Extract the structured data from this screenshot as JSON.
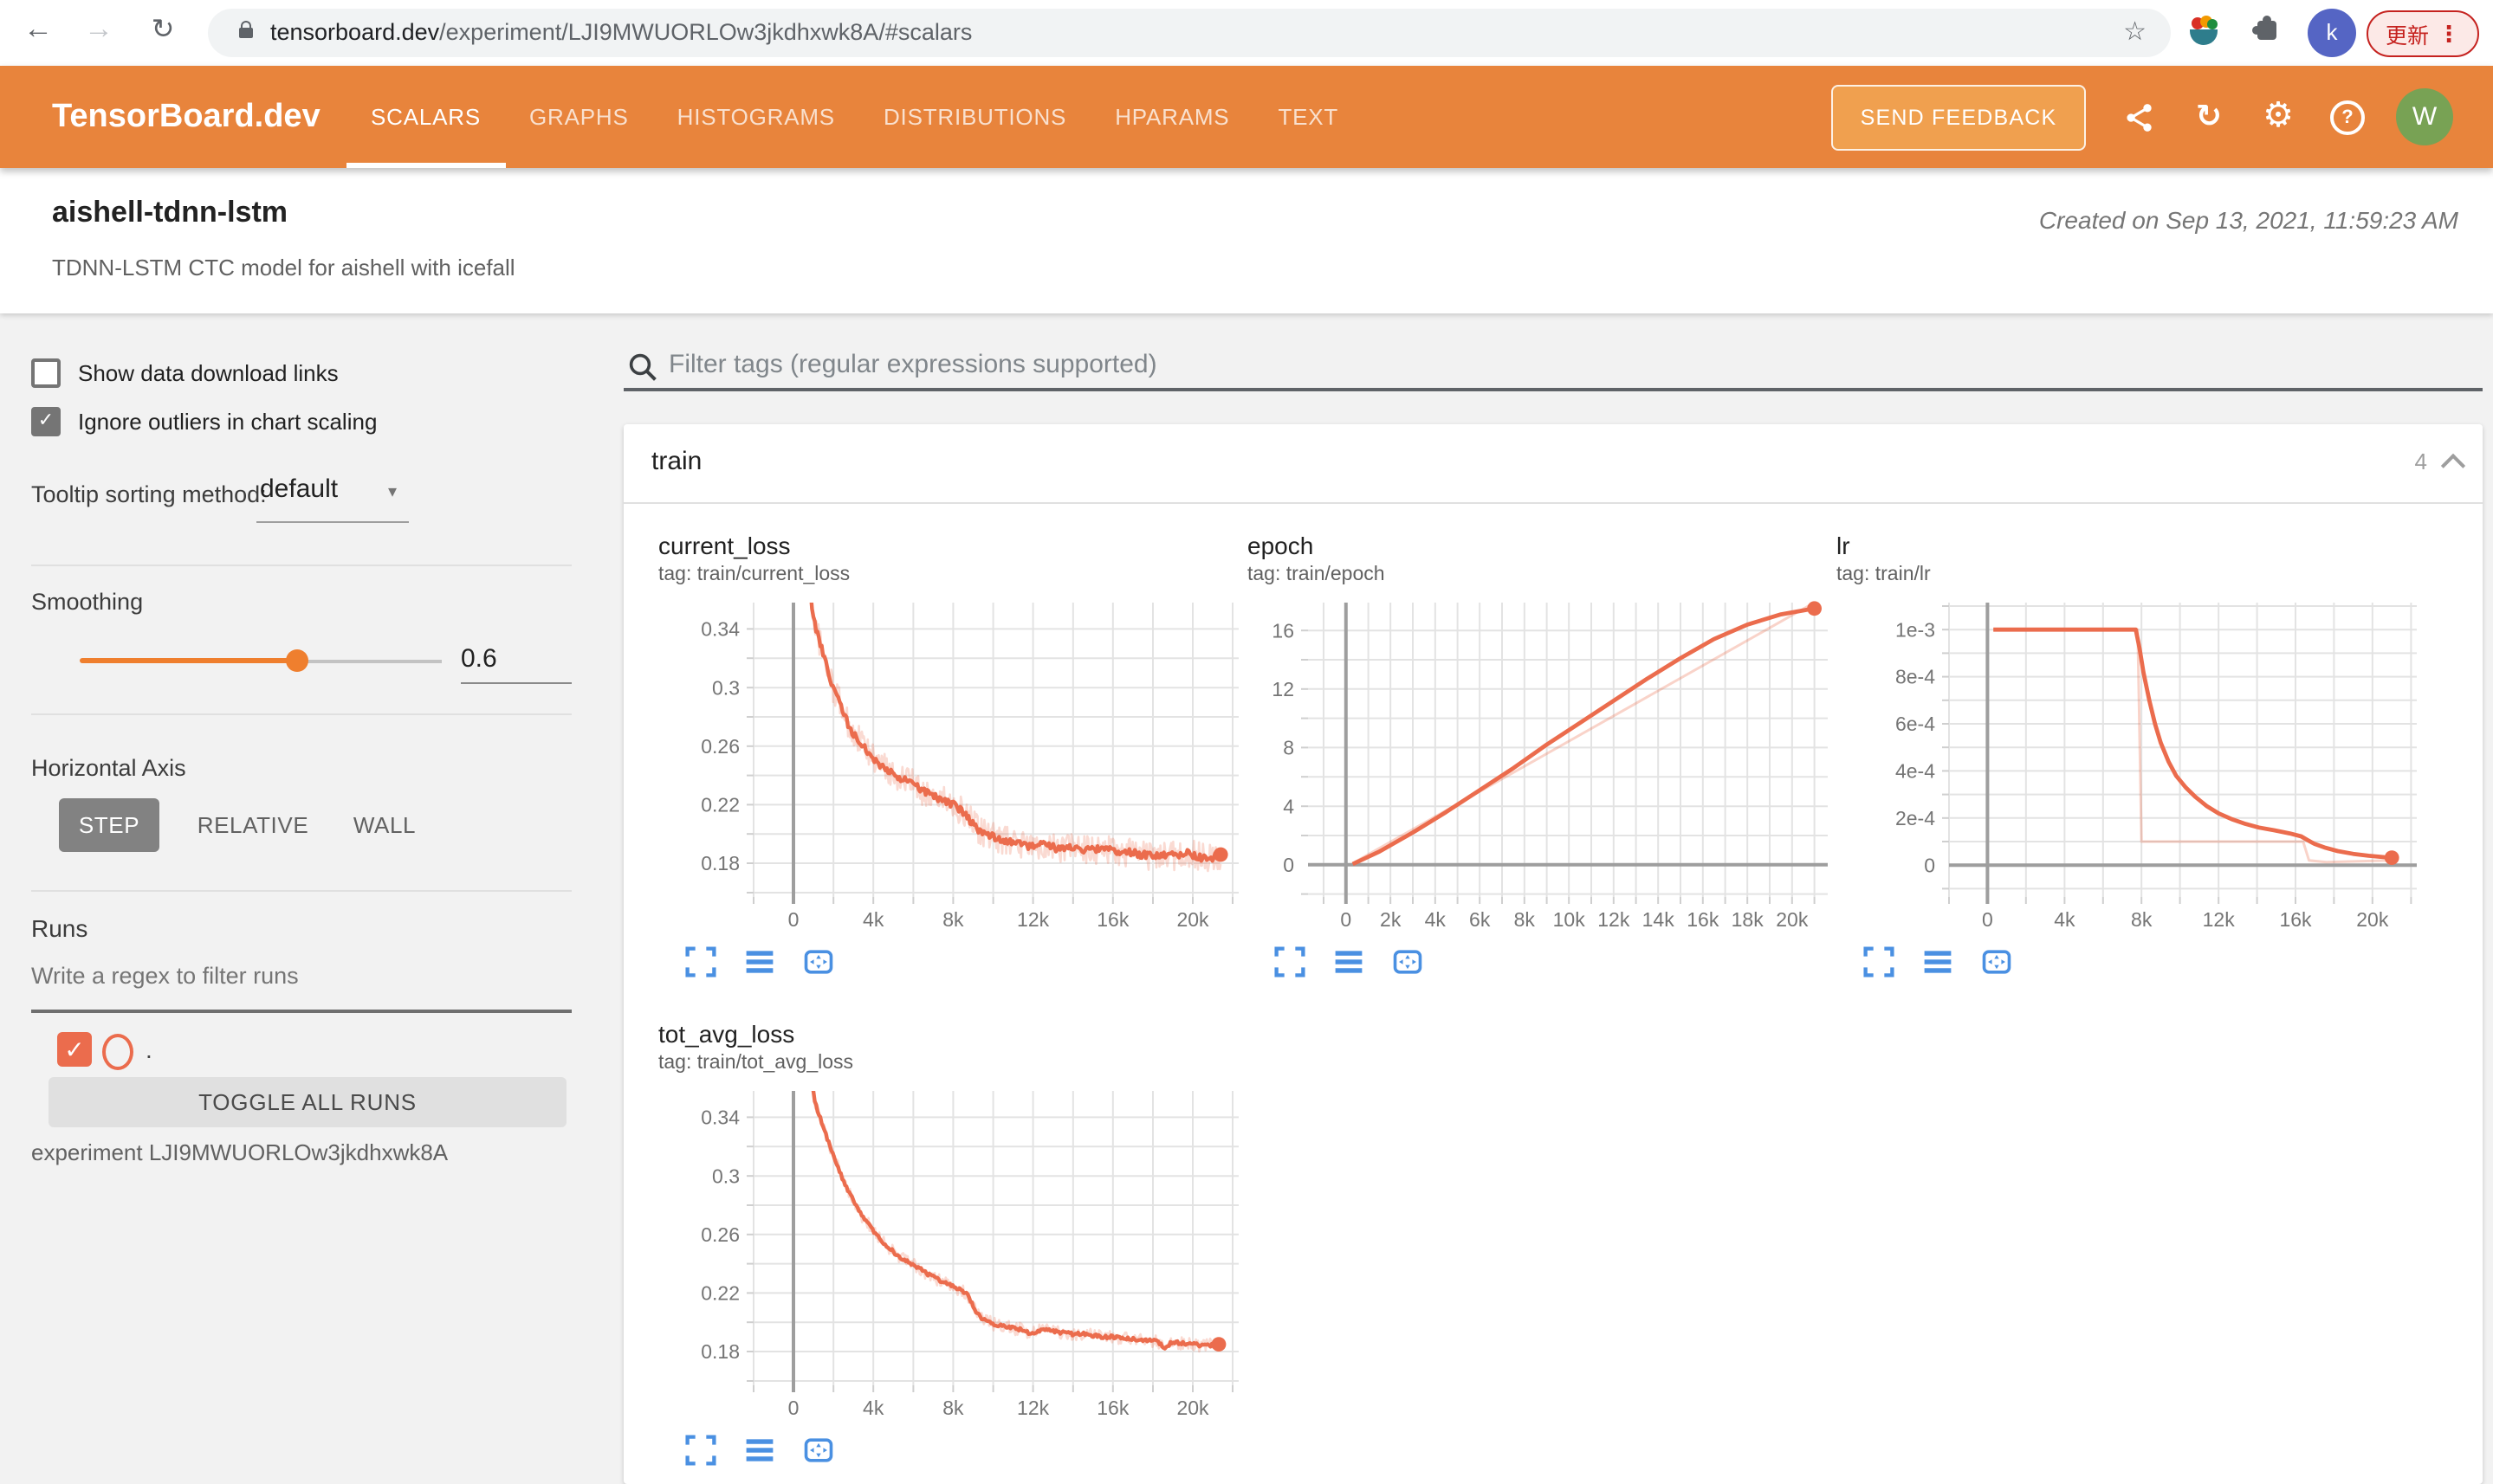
{
  "browser": {
    "url_host": "tensorboard.dev",
    "url_path": "/experiment/LJI9MWUORLOw3jkdhxwk8A/#scalars",
    "update_label": "更新",
    "profile_initial": "k"
  },
  "icons": {
    "back": "←",
    "forward": "→",
    "reload": "↻",
    "star": "☆",
    "dots": "⋮",
    "check": "✓",
    "dropdown": "▾",
    "help_q": "?",
    "gear": "⚙"
  },
  "header": {
    "logo": "TensorBoard.dev",
    "tabs": [
      {
        "label": "SCALARS",
        "active": true
      },
      {
        "label": "GRAPHS"
      },
      {
        "label": "HISTOGRAMS"
      },
      {
        "label": "DISTRIBUTIONS"
      },
      {
        "label": "HPARAMS"
      },
      {
        "label": "TEXT"
      }
    ],
    "feedback_label": "SEND FEEDBACK",
    "avatar_initial": "W"
  },
  "experiment": {
    "name": "aishell-tdnn-lstm",
    "description": "TDNN-LSTM CTC model for aishell with icefall",
    "created": "Created on Sep 13, 2021, 11:59:23 AM"
  },
  "sidebar": {
    "show_links_label": "Show data download links",
    "ignore_outliers_label": "Ignore outliers in chart scaling",
    "tooltip_label": "Tooltip sorting method:",
    "tooltip_value": "default",
    "smoothing_label": "Smoothing",
    "smoothing_value": "0.6",
    "haxis_label": "Horizontal Axis",
    "haxis_options": [
      {
        "label": "STEP",
        "active": true
      },
      {
        "label": "RELATIVE"
      },
      {
        "label": "WALL"
      }
    ],
    "runs_label": "Runs",
    "runs_placeholder": "Write a regex to filter runs",
    "run_dot": ".",
    "toggle_label": "TOGGLE ALL RUNS",
    "experiment_line": "experiment LJI9MWUORLOw3jkdhxwk8A"
  },
  "main": {
    "filter_placeholder": "Filter tags (regular expressions supported)",
    "group": {
      "name": "train",
      "count": "4"
    }
  },
  "colors": {
    "accent": "#e8843c",
    "accent_light": "#f0a04f",
    "line": "#eb6c4d",
    "tool_blue": "#4a90e2",
    "update_red": "#c5221f"
  },
  "chart_data": [
    {
      "type": "line",
      "title": "current_loss",
      "tag": "tag: train/current_loss",
      "xlim": [
        -2000,
        22300
      ],
      "ylim": [
        0.157,
        0.358
      ],
      "xgrid": 2000,
      "ygrid": 0.02,
      "layout": {
        "gutter": 55
      },
      "xticks": [
        {
          "v": 0,
          "l": "0"
        },
        {
          "v": 4000,
          "l": "4k"
        },
        {
          "v": 8000,
          "l": "8k"
        },
        {
          "v": 12000,
          "l": "12k"
        },
        {
          "v": 16000,
          "l": "16k"
        },
        {
          "v": 20000,
          "l": "20k"
        }
      ],
      "yticks": [
        {
          "v": 0.18,
          "l": "0.18"
        },
        {
          "v": 0.22,
          "l": "0.22"
        },
        {
          "v": 0.26,
          "l": "0.26"
        },
        {
          "v": 0.3,
          "l": "0.3"
        },
        {
          "v": 0.34,
          "l": "0.34"
        }
      ],
      "series": [
        {
          "name": "raw",
          "points_from": 1,
          "noise": 0.01,
          "nsamples": 420,
          "width": 1.3,
          "opacity": 0.25
        },
        {
          "name": "smoothed",
          "noise": 0.0025,
          "nsamples": 300,
          "width": 2.2,
          "opacity": 1,
          "end_dot": true,
          "points": [
            [
              650,
              0.4
            ],
            [
              800,
              0.372
            ],
            [
              950,
              0.352
            ],
            [
              1100,
              0.342
            ],
            [
              1300,
              0.332
            ],
            [
              1500,
              0.322
            ],
            [
              1700,
              0.312
            ],
            [
              1900,
              0.303
            ],
            [
              2100,
              0.296
            ],
            [
              2300,
              0.291
            ],
            [
              2500,
              0.284
            ],
            [
              2700,
              0.276
            ],
            [
              2900,
              0.269
            ],
            [
              3200,
              0.265
            ],
            [
              3500,
              0.261
            ],
            [
              3800,
              0.254
            ],
            [
              4100,
              0.25
            ],
            [
              4500,
              0.246
            ],
            [
              5000,
              0.241
            ],
            [
              5500,
              0.237
            ],
            [
              6000,
              0.234
            ],
            [
              6500,
              0.229
            ],
            [
              7000,
              0.226
            ],
            [
              7500,
              0.223
            ],
            [
              8000,
              0.22
            ],
            [
              8400,
              0.216
            ],
            [
              8800,
              0.21
            ],
            [
              9200,
              0.203
            ],
            [
              9600,
              0.2
            ],
            [
              10000,
              0.198
            ],
            [
              10500,
              0.196
            ],
            [
              11000,
              0.195
            ],
            [
              11500,
              0.193
            ],
            [
              12000,
              0.191
            ],
            [
              12600,
              0.193
            ],
            [
              13200,
              0.19
            ],
            [
              13800,
              0.191
            ],
            [
              14400,
              0.19
            ],
            [
              15000,
              0.189
            ],
            [
              15600,
              0.19
            ],
            [
              16200,
              0.187
            ],
            [
              16800,
              0.188
            ],
            [
              17400,
              0.186
            ],
            [
              18000,
              0.185
            ],
            [
              18600,
              0.186
            ],
            [
              19200,
              0.185
            ],
            [
              19800,
              0.187
            ],
            [
              20400,
              0.184
            ],
            [
              21000,
              0.184
            ],
            [
              21400,
              0.186
            ]
          ]
        }
      ]
    },
    {
      "type": "line",
      "title": "epoch",
      "tag": "tag: train/epoch",
      "xlim": [
        -1700,
        21600
      ],
      "ylim": [
        -2.2,
        17.9
      ],
      "xgrid": 1000,
      "ygrid": 2,
      "zero_line": true,
      "layout": {
        "gutter": 35
      },
      "xticks": [
        {
          "v": 0,
          "l": "0"
        },
        {
          "v": 2000,
          "l": "2k"
        },
        {
          "v": 4000,
          "l": "4k"
        },
        {
          "v": 6000,
          "l": "6k"
        },
        {
          "v": 8000,
          "l": "8k"
        },
        {
          "v": 10000,
          "l": "10k"
        },
        {
          "v": 12000,
          "l": "12k"
        },
        {
          "v": 14000,
          "l": "14k"
        },
        {
          "v": 16000,
          "l": "16k"
        },
        {
          "v": 18000,
          "l": "18k"
        },
        {
          "v": 20000,
          "l": "20k"
        }
      ],
      "yticks": [
        {
          "v": 0,
          "l": "0"
        },
        {
          "v": 4,
          "l": "4"
        },
        {
          "v": 8,
          "l": "8"
        },
        {
          "v": 12,
          "l": "12"
        },
        {
          "v": 16,
          "l": "16"
        }
      ],
      "series": [
        {
          "name": "raw",
          "width": 1.5,
          "opacity": 0.3,
          "points": [
            [
              300,
              0.1
            ],
            [
              21000,
              17.9
            ]
          ]
        },
        {
          "name": "smoothed",
          "width": 2.4,
          "opacity": 1,
          "end_dot": true,
          "points": [
            [
              300,
              0.05
            ],
            [
              1500,
              0.9
            ],
            [
              3000,
              2.2
            ],
            [
              4500,
              3.6
            ],
            [
              6000,
              5.1
            ],
            [
              7500,
              6.6
            ],
            [
              9000,
              8.2
            ],
            [
              10500,
              9.7
            ],
            [
              12000,
              11.2
            ],
            [
              13500,
              12.7
            ],
            [
              15000,
              14.1
            ],
            [
              16500,
              15.4
            ],
            [
              18000,
              16.4
            ],
            [
              19500,
              17.1
            ],
            [
              21000,
              17.5
            ]
          ]
        }
      ]
    },
    {
      "type": "line",
      "title": "lr",
      "tag": "tag: train/lr",
      "xlim": [
        -2000,
        22300
      ],
      "ylim": [
        -0.000135,
        0.001115
      ],
      "xgrid": 2000,
      "ygrid": 0.0001,
      "zero_line": true,
      "layout": {
        "gutter": 65
      },
      "xticks": [
        {
          "v": 0,
          "l": "0"
        },
        {
          "v": 4000,
          "l": "4k"
        },
        {
          "v": 8000,
          "l": "8k"
        },
        {
          "v": 12000,
          "l": "12k"
        },
        {
          "v": 16000,
          "l": "16k"
        },
        {
          "v": 20000,
          "l": "20k"
        }
      ],
      "yticks": [
        {
          "v": 0,
          "l": "0"
        },
        {
          "v": 0.0002,
          "l": "2e-4"
        },
        {
          "v": 0.0004,
          "l": "4e-4"
        },
        {
          "v": 0.0006,
          "l": "6e-4"
        },
        {
          "v": 0.0008,
          "l": "8e-4"
        },
        {
          "v": 0.001,
          "l": "1e-3"
        }
      ],
      "series": [
        {
          "name": "raw",
          "width": 1.5,
          "opacity": 0.3,
          "points": [
            [
              300,
              0.001
            ],
            [
              7800,
              0.001
            ],
            [
              8000,
              0.0001
            ],
            [
              16400,
              0.0001
            ],
            [
              16700,
              2e-05
            ],
            [
              17600,
              1.3e-05
            ],
            [
              21000,
              2e-05
            ]
          ]
        },
        {
          "name": "smoothed",
          "width": 2.4,
          "opacity": 1,
          "end_dot": true,
          "points": [
            [
              300,
              0.001
            ],
            [
              7700,
              0.001
            ],
            [
              7900,
              0.00092
            ],
            [
              8100,
              0.00082
            ],
            [
              8400,
              0.0007
            ],
            [
              8700,
              0.0006
            ],
            [
              9000,
              0.00052
            ],
            [
              9400,
              0.00044
            ],
            [
              9800,
              0.00038
            ],
            [
              10300,
              0.00033
            ],
            [
              10800,
              0.00029
            ],
            [
              11400,
              0.00025
            ],
            [
              12000,
              0.00022
            ],
            [
              12700,
              0.000195
            ],
            [
              13400,
              0.000175
            ],
            [
              14100,
              0.00016
            ],
            [
              14900,
              0.000148
            ],
            [
              15700,
              0.000135
            ],
            [
              16300,
              0.000122
            ],
            [
              16600,
              0.000108
            ],
            [
              17000,
              9e-05
            ],
            [
              17500,
              7.5e-05
            ],
            [
              18200,
              6e-05
            ],
            [
              19000,
              4.8e-05
            ],
            [
              19800,
              4e-05
            ],
            [
              20600,
              3.4e-05
            ],
            [
              21000,
              3.2e-05
            ]
          ]
        }
      ]
    },
    {
      "type": "line",
      "title": "tot_avg_loss",
      "tag": "tag: train/tot_avg_loss",
      "xlim": [
        -2000,
        22300
      ],
      "ylim": [
        0.157,
        0.358
      ],
      "xgrid": 2000,
      "ygrid": 0.02,
      "layout": {
        "gutter": 55
      },
      "xticks": [
        {
          "v": 0,
          "l": "0"
        },
        {
          "v": 4000,
          "l": "4k"
        },
        {
          "v": 8000,
          "l": "8k"
        },
        {
          "v": 12000,
          "l": "12k"
        },
        {
          "v": 16000,
          "l": "16k"
        },
        {
          "v": 20000,
          "l": "20k"
        }
      ],
      "yticks": [
        {
          "v": 0.18,
          "l": "0.18"
        },
        {
          "v": 0.22,
          "l": "0.22"
        },
        {
          "v": 0.26,
          "l": "0.26"
        },
        {
          "v": 0.3,
          "l": "0.3"
        },
        {
          "v": 0.34,
          "l": "0.34"
        }
      ],
      "series": [
        {
          "name": "raw",
          "points_from": 1,
          "noise": 0.0045,
          "nsamples": 380,
          "width": 1.3,
          "opacity": 0.25
        },
        {
          "name": "smoothed",
          "noise": 0.0012,
          "nsamples": 300,
          "width": 2.2,
          "opacity": 1,
          "end_dot": true,
          "points": [
            [
              650,
              0.4
            ],
            [
              800,
              0.378
            ],
            [
              950,
              0.361
            ],
            [
              1100,
              0.349
            ],
            [
              1250,
              0.343
            ],
            [
              1400,
              0.337
            ],
            [
              1600,
              0.329
            ],
            [
              1800,
              0.321
            ],
            [
              2000,
              0.314
            ],
            [
              2200,
              0.307
            ],
            [
              2400,
              0.3
            ],
            [
              2600,
              0.294
            ],
            [
              2800,
              0.288
            ],
            [
              3000,
              0.283
            ],
            [
              3200,
              0.278
            ],
            [
              3500,
              0.271
            ],
            [
              3800,
              0.266
            ],
            [
              4100,
              0.26
            ],
            [
              4400,
              0.256
            ],
            [
              4700,
              0.252
            ],
            [
              5000,
              0.248
            ],
            [
              5400,
              0.244
            ],
            [
              5800,
              0.241
            ],
            [
              6200,
              0.238
            ],
            [
              6600,
              0.234
            ],
            [
              7000,
              0.231
            ],
            [
              7400,
              0.228
            ],
            [
              7800,
              0.226
            ],
            [
              8200,
              0.223
            ],
            [
              8500,
              0.221
            ],
            [
              8700,
              0.219
            ],
            [
              8900,
              0.214
            ],
            [
              9100,
              0.208
            ],
            [
              9400,
              0.203
            ],
            [
              9700,
              0.201
            ],
            [
              10000,
              0.199
            ],
            [
              10500,
              0.197
            ],
            [
              11000,
              0.196
            ],
            [
              11500,
              0.195
            ],
            [
              11900,
              0.192
            ],
            [
              12300,
              0.194
            ],
            [
              12800,
              0.195
            ],
            [
              13400,
              0.193
            ],
            [
              14000,
              0.192
            ],
            [
              14700,
              0.192
            ],
            [
              15400,
              0.19
            ],
            [
              16100,
              0.19
            ],
            [
              16800,
              0.189
            ],
            [
              17500,
              0.188
            ],
            [
              18200,
              0.187
            ],
            [
              18600,
              0.182
            ],
            [
              18900,
              0.186
            ],
            [
              19400,
              0.186
            ],
            [
              20000,
              0.185
            ],
            [
              20600,
              0.184
            ],
            [
              21300,
              0.185
            ]
          ]
        }
      ]
    }
  ]
}
